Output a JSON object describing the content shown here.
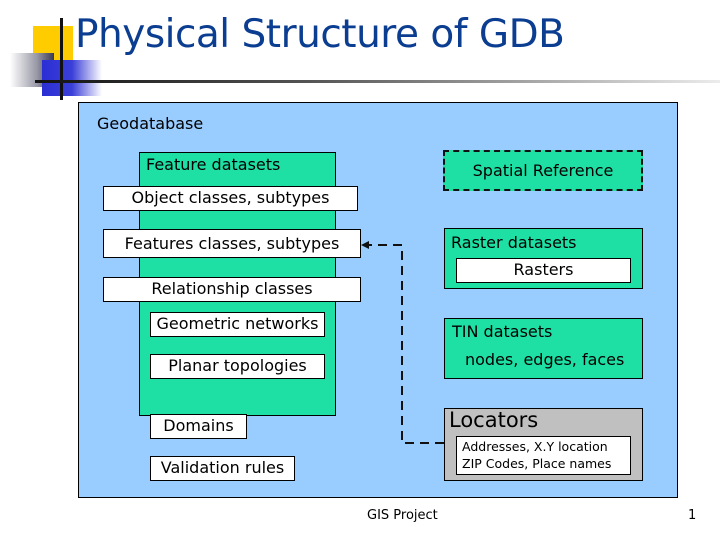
{
  "slide": {
    "title": "Physical Structure of GDB",
    "footer": "GIS Project",
    "page_number": "1"
  },
  "diagram": {
    "container_label": "Geodatabase",
    "feature_datasets": {
      "label": "Feature datasets",
      "items": [
        "Object classes, subtypes",
        "Features classes, subtypes",
        "Relationship classes",
        "Geometric networks",
        "Planar topologies"
      ]
    },
    "spatial_reference": "Spatial Reference",
    "raster_datasets": {
      "label": "Raster datasets",
      "item": "Rasters"
    },
    "tin_datasets": {
      "label": "TIN datasets",
      "item": "nodes, edges, faces"
    },
    "domains": "Domains",
    "validation_rules": "Validation rules",
    "locators": {
      "label": "Locators",
      "lines": [
        "Addresses, X.Y location",
        "ZIP Codes, Place names"
      ]
    },
    "colors": {
      "container": "#99ccff",
      "dataset": "#1ee0a4",
      "locator": "#c0c0c0",
      "title": "#0b3d91"
    }
  }
}
